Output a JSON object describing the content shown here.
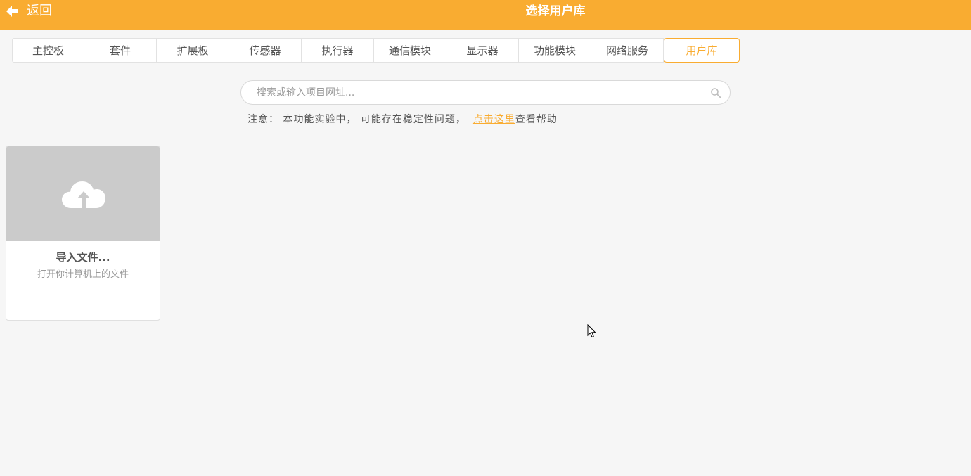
{
  "header": {
    "back_label": "返回",
    "title": "选择用户库",
    "back_icon": "arrow-left-icon",
    "color": "#f9ac31"
  },
  "tabs": [
    {
      "label": "主控板",
      "active": false
    },
    {
      "label": "套件",
      "active": false
    },
    {
      "label": "扩展板",
      "active": false
    },
    {
      "label": "传感器",
      "active": false
    },
    {
      "label": "执行器",
      "active": false
    },
    {
      "label": "通信模块",
      "active": false
    },
    {
      "label": "显示器",
      "active": false
    },
    {
      "label": "功能模块",
      "active": false
    },
    {
      "label": "网络服务",
      "active": false
    },
    {
      "label": "用户库",
      "active": true
    }
  ],
  "search": {
    "value": "",
    "placeholder": "搜索或输入项目网址...",
    "icon": "search-icon"
  },
  "notice": {
    "prefix": "注意： 本功能实验中， 可能存在稳定性问题，",
    "link": "点击这里",
    "suffix": "查看帮助"
  },
  "import_card": {
    "icon": "cloud-upload-icon",
    "title": "导入文件...",
    "description": "打开你计算机上的文件"
  }
}
